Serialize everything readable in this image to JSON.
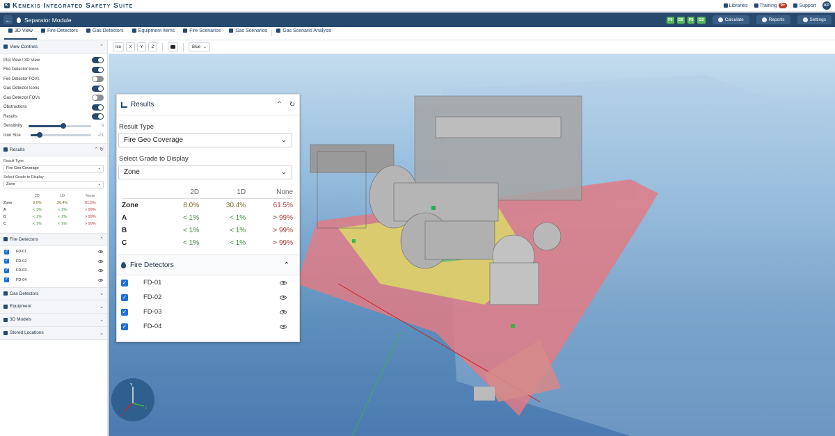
{
  "app": {
    "title": "Kenexis Integrated Safety Suite",
    "logo_letter": "K"
  },
  "topnav": {
    "libraries": "Libraries",
    "training": "Training",
    "training_badge": "9+",
    "support": "Support",
    "user_initials": "KP"
  },
  "module": {
    "title": "Separator Module",
    "grades": [
      "F6",
      "G6",
      "F5",
      "G5"
    ],
    "calculate": "Calculate",
    "reports": "Reports",
    "settings": "Settings"
  },
  "tabs": [
    "3D View",
    "Fire Detectors",
    "Gas Detectors",
    "Equipment Items",
    "Fire Scenarios",
    "Gas Scenarios",
    "Gas Scenario Analysis"
  ],
  "viewer_toolbar": {
    "iso": "Iso",
    "x": "X",
    "y": "Y",
    "z": "Z",
    "color": "Blue"
  },
  "sidebar": {
    "view_controls": {
      "title": "View Controls",
      "toggles": [
        {
          "label": "Plot View / 3D View",
          "on": true
        },
        {
          "label": "Fire Detector Icons",
          "on": true
        },
        {
          "label": "Fire Detector FOVs",
          "on": false
        },
        {
          "label": "Gas Detector Icons",
          "on": true
        },
        {
          "label": "Gas Detector FOVs",
          "on": false
        },
        {
          "label": "Obstructions",
          "on": true
        },
        {
          "label": "Results",
          "on": true
        }
      ],
      "sensitivity_label": "Sensitivity",
      "sensitivity_value": "5",
      "sensitivity_level": 0.55,
      "icon_size_label": "Icon Size",
      "icon_size_value": "-2.1",
      "icon_size_level": 0.15
    },
    "results": {
      "title": "Results",
      "result_type_label": "Result Type",
      "result_type": "Fire Geo Coverage",
      "grade_label": "Select Grade to Display",
      "grade": "Zone",
      "headers": [
        "2D",
        "1D",
        "None"
      ],
      "rows": [
        {
          "label": "Zone",
          "v2d": "8.0%",
          "v1d": "30.4%",
          "none": "61.5%"
        },
        {
          "label": "A",
          "v2d": "< 1%",
          "v1d": "< 1%",
          "none": "> 99%"
        },
        {
          "label": "B",
          "v2d": "< 1%",
          "v1d": "< 1%",
          "none": "> 99%"
        },
        {
          "label": "C",
          "v2d": "< 1%",
          "v1d": "< 1%",
          "none": "> 99%"
        }
      ]
    },
    "fire_detectors": {
      "title": "Fire Detectors",
      "items": [
        "FD-01",
        "FD-02",
        "FD-03",
        "FD-04"
      ]
    },
    "collapsed_sections": [
      "Gas Detectors",
      "Equipment",
      "3D Models",
      "Stored Locations"
    ]
  },
  "gizmo": {
    "x": "X",
    "y": "Y",
    "z": "Z"
  },
  "colors": {
    "primary": "#27496d",
    "accent": "#1f6fd6",
    "good": "#3b8a3b",
    "bad": "#b03a3a",
    "grade_chip": "#5bb85d"
  }
}
